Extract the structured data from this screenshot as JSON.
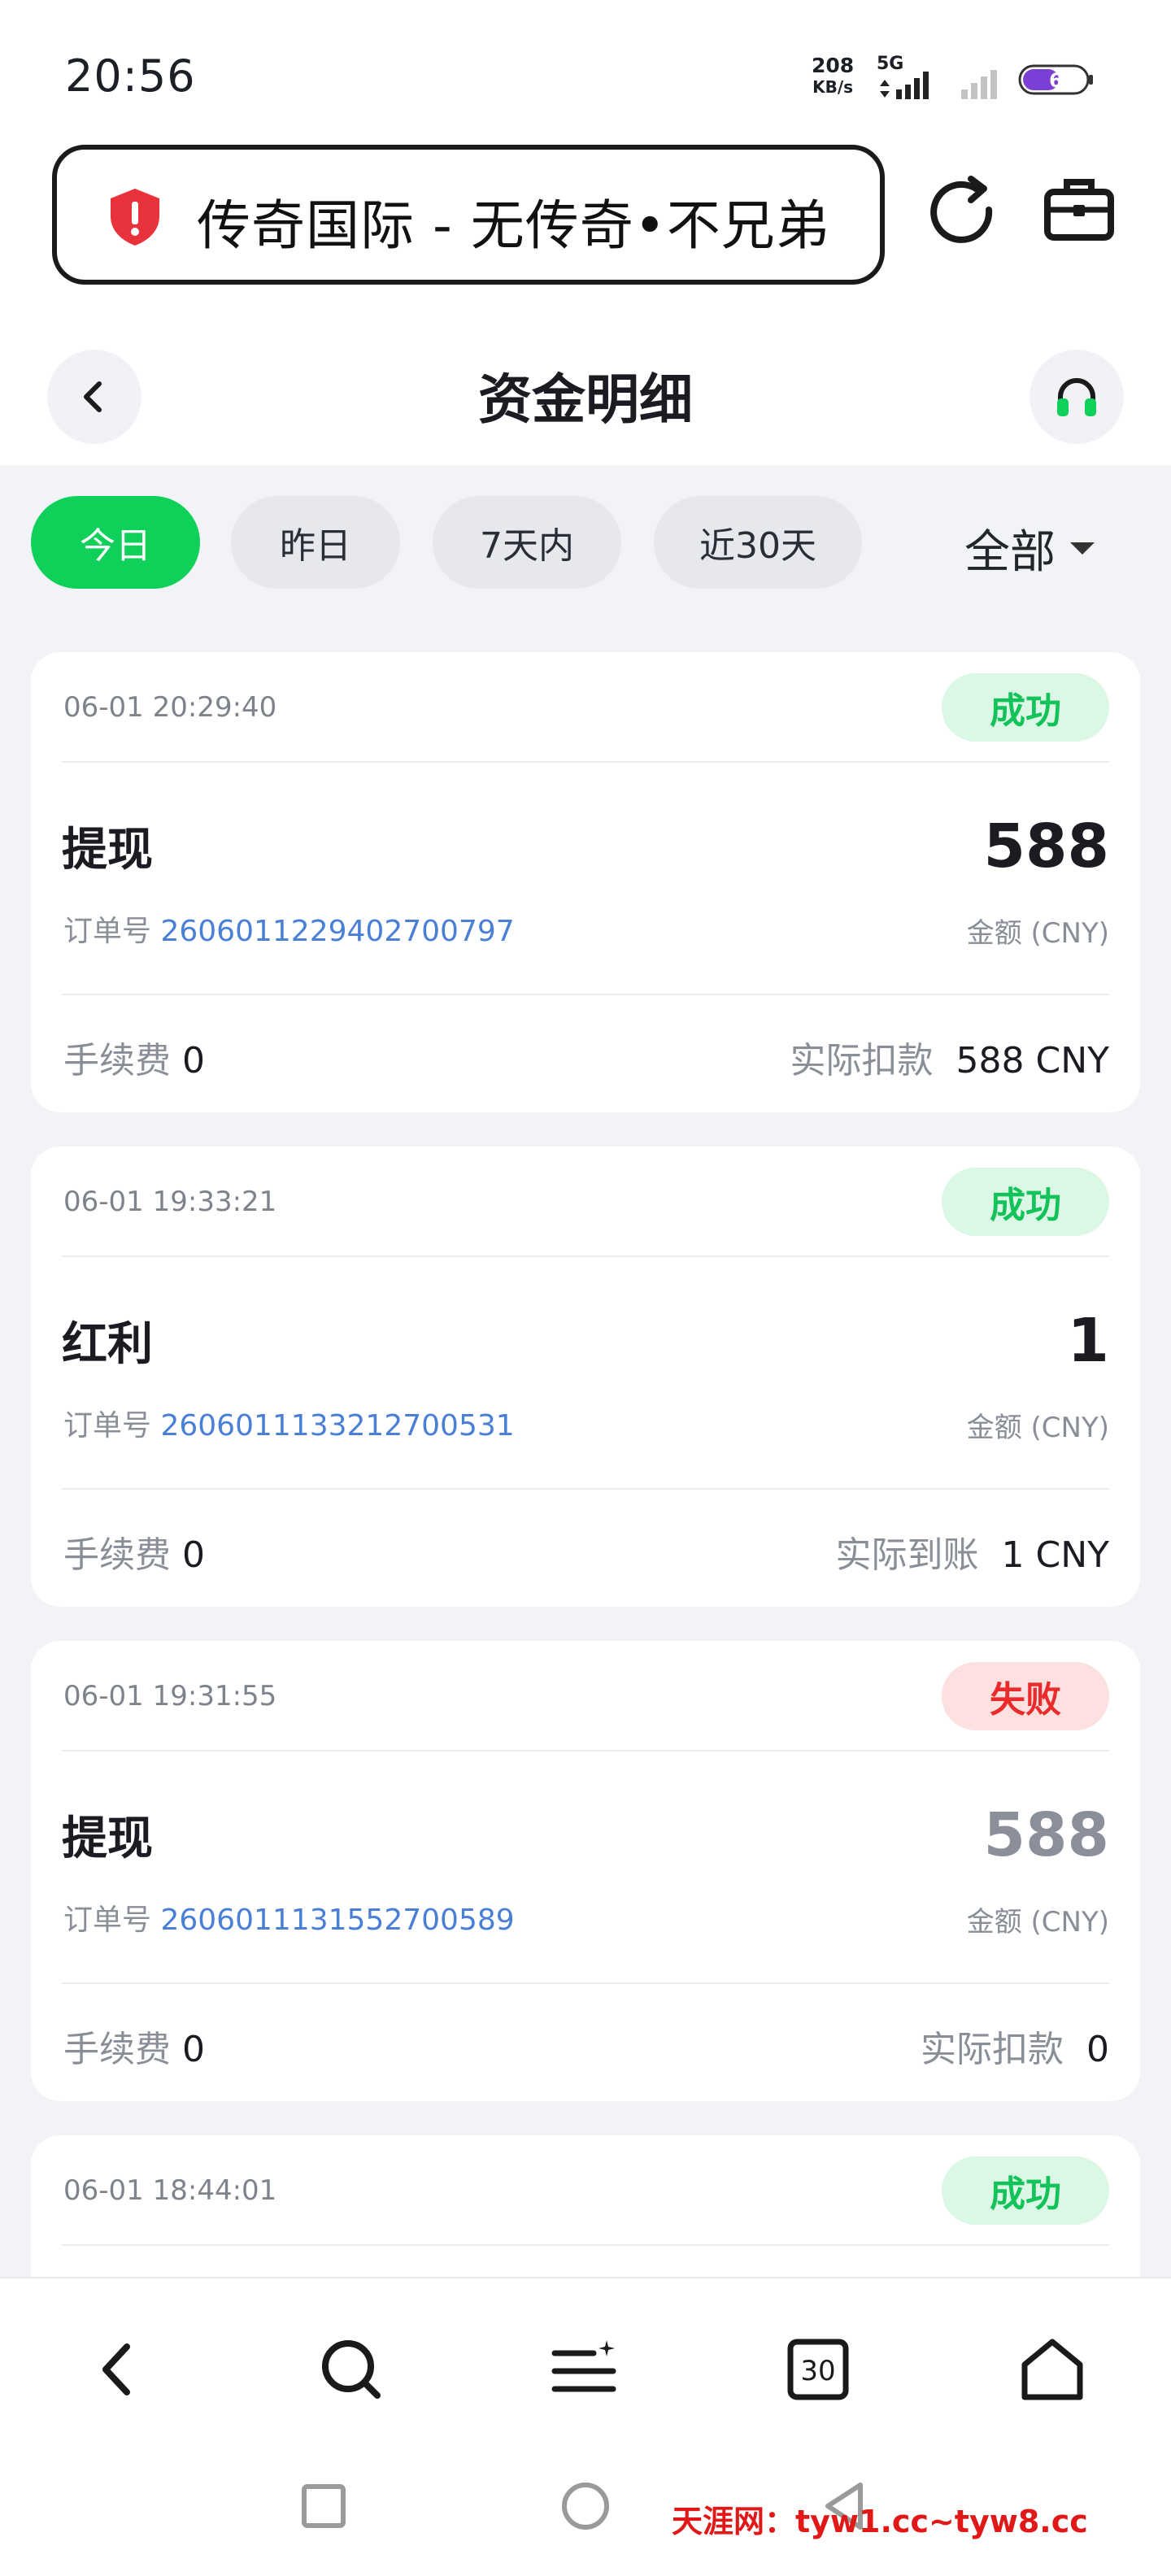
{
  "status_bar": {
    "time": "20:56",
    "net_speed": "208",
    "net_unit": "KB/s",
    "network_type": "5G",
    "battery": "6"
  },
  "url_bar": {
    "title": "传奇国际 - 无传奇•不兄弟"
  },
  "header": {
    "title": "资金明细"
  },
  "filters": {
    "chips": [
      "今日",
      "昨日",
      "7天内",
      "近30天"
    ],
    "active": "今日",
    "type_dropdown": "全部"
  },
  "records": [
    {
      "time": "06-01 20:29:40",
      "status": "成功",
      "type": "提现",
      "order_label": "订单号",
      "order_no": "2606011229402700797",
      "amount": "588",
      "amount_label": "金额 (CNY)",
      "fee_label": "手续费",
      "fee": "0",
      "actual_label": "实际扣款",
      "actual": "588 CNY"
    },
    {
      "time": "06-01 19:33:21",
      "status": "成功",
      "type": "红利",
      "order_label": "订单号",
      "order_no": "2606011133212700531",
      "amount": "1",
      "amount_label": "金额 (CNY)",
      "fee_label": "手续费",
      "fee": "0",
      "actual_label": "实际到账",
      "actual": "1 CNY"
    },
    {
      "time": "06-01 19:31:55",
      "status": "失败",
      "type": "提现",
      "order_label": "订单号",
      "order_no": "2606011131552700589",
      "amount": "588",
      "amount_label": "金额 (CNY)",
      "fee_label": "手续费",
      "fee": "0",
      "actual_label": "实际扣款",
      "actual": "0"
    },
    {
      "time": "06-01 18:44:01",
      "status": "成功"
    }
  ],
  "bottom_nav": {
    "icons": [
      "back-icon",
      "search-icon",
      "menu-icon",
      "tabs-icon",
      "home-icon"
    ],
    "tabs_count": "30"
  },
  "watermark": "天涯网：tyw1.cc~tyw8.cc",
  "colors": {
    "accent_green": "#0fd15a",
    "success_text": "#14c25a",
    "fail_text": "#ea2b2b",
    "order_link": "#4a7fd6"
  }
}
